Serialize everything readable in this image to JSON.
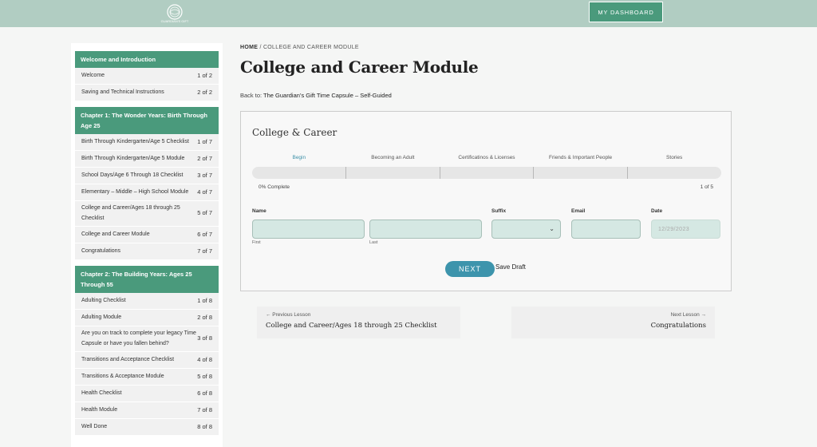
{
  "header": {
    "logo_text": "GUARDIAN'S GIFT",
    "dashboard_label": "MY DASHBOARD"
  },
  "sidebar": {
    "sections": [
      {
        "title": "Welcome and Introduction",
        "items": [
          {
            "label": "Welcome",
            "count": "1 of 2"
          },
          {
            "label": "Saving and Technical Instructions",
            "count": "2 of 2"
          }
        ]
      },
      {
        "title": "Chapter 1: The Wonder Years: Birth Through Age 25",
        "items": [
          {
            "label": "Birth Through Kindergarten/Age 5 Checklist",
            "count": "1 of 7"
          },
          {
            "label": "Birth Through Kindergarten/Age 5 Module",
            "count": "2 of 7"
          },
          {
            "label": "School Days/Age 6 Through 18 Checklist",
            "count": "3 of 7"
          },
          {
            "label": "Elementary – Middle – High School Module",
            "count": "4 of 7"
          },
          {
            "label": "College and Career/Ages 18 through 25 Checklist",
            "count": "5 of 7"
          },
          {
            "label": "College and Career Module",
            "count": "6 of 7"
          },
          {
            "label": "Congratulations",
            "count": "7 of 7"
          }
        ]
      },
      {
        "title": "Chapter 2: The Building Years: Ages 25 Through 55",
        "items": [
          {
            "label": "Adulting Checklist",
            "count": "1 of 8"
          },
          {
            "label": "Adulting Module",
            "count": "2 of 8"
          },
          {
            "label": "Are you on track to complete your legacy Time Capsule or have you fallen behind?",
            "count": "3 of 8"
          },
          {
            "label": "Transitions and Acceptance Checklist",
            "count": "4 of 8"
          },
          {
            "label": "Transitions & Acceptance Module",
            "count": "5 of 8"
          },
          {
            "label": "Health Checklist",
            "count": "6 of 8"
          },
          {
            "label": "Health Module",
            "count": "7 of 8"
          },
          {
            "label": "Well Done",
            "count": "8 of 8"
          }
        ]
      }
    ]
  },
  "main": {
    "breadcrumb_home": "HOME",
    "breadcrumb_sep": " / ",
    "breadcrumb_current": "COLLEGE AND CAREER MODULE",
    "title": "College and Career Module",
    "back_prefix": "Back to: ",
    "back_link": "The Guardian’s Gift Time Capsule – Self-Guided"
  },
  "form": {
    "title": "College & Career",
    "steps": [
      "Begin",
      "Becoming an Adult",
      "Certificatinos & Licenses",
      "Friends & Important People",
      "Stories"
    ],
    "progress_percent": 0,
    "progress_text": "0% Complete",
    "page_text": "1 of 5",
    "labels": {
      "name": "Name",
      "suffix": "Suffix",
      "email": "Email",
      "date": "Date"
    },
    "sublabels": {
      "first": "First",
      "last": "Last"
    },
    "date_placeholder": "12/29/2023",
    "next_label": "NEXT",
    "draft_label": "Save Draft"
  },
  "lesson_nav": {
    "prev_small": "← Previous Lesson",
    "prev_title": "College and Career/Ages 18 through 25 Checklist",
    "next_small": "Next Lesson →",
    "next_title": "Congratulations"
  },
  "colors": {
    "accent": "#4a9a7c",
    "header": "#b1cdc2",
    "button": "#3d94ac",
    "input": "#d5e8e3"
  }
}
